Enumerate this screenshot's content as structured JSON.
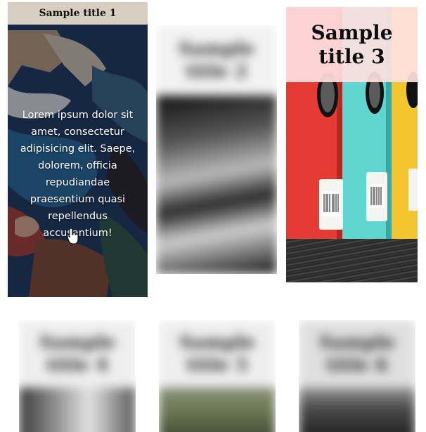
{
  "cards": [
    {
      "title": "Sample title 1",
      "text": "Lorem ipsum dolor sit amet, consectetur adipisicing elit. Saepe, dolorem, officia repudiandae praesentium quasi repellendus accusantium!"
    },
    {
      "title": "Sample title 2"
    },
    {
      "title": "Sample title 3"
    },
    {
      "title": "Sample title 4"
    },
    {
      "title": "Sample title 5"
    },
    {
      "title": "Sample title 6"
    }
  ],
  "cursor": {
    "icon": "hand-pointer-icon"
  },
  "colors": {
    "card1_title_bg": "#d7cec2",
    "card3_title_bg": "#ffe1e1",
    "binder_red": "#e53b32",
    "binder_teal": "#5fd6cf",
    "binder_yellow": "#f3c630"
  }
}
